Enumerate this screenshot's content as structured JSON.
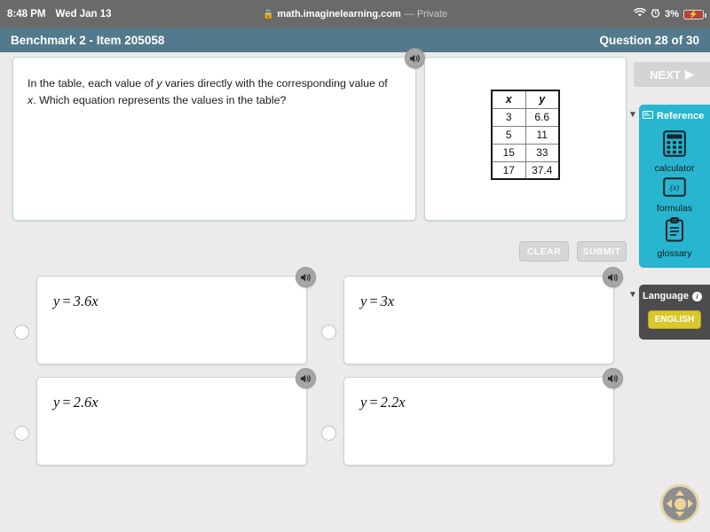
{
  "statusbar": {
    "time": "8:48 PM",
    "date": "Wed Jan 13",
    "lock_icon": "lock-icon",
    "url": "math.imaginelearning.com",
    "private_label": "— Private",
    "wifi_icon": "wifi-icon",
    "alarm_icon": "alarm-clock-icon",
    "battery_percent": "3%",
    "battery_icon": "battery-charging-icon",
    "bg_color": "#6a6a6a"
  },
  "header": {
    "title": "Benchmark 2 - Item 205058",
    "progress": "Question 28 of 30",
    "bg_color": "#52798c"
  },
  "question": {
    "speaker_icon": "speaker-icon",
    "line1_a": "In the table, each value of ",
    "line1_y": "y",
    "line1_b": " varies directly with the corresponding value of",
    "line2_x": "x",
    "line2_b": ". Which equation represents the values in the table?"
  },
  "stimulus_table": {
    "headers": [
      "x",
      "y"
    ],
    "rows": [
      [
        "3",
        "6.6"
      ],
      [
        "5",
        "11"
      ],
      [
        "15",
        "33"
      ],
      [
        "17",
        "37.4"
      ]
    ]
  },
  "actions": {
    "clear_label": "CLEAR",
    "submit_label": "SUBMIT",
    "disabled": true
  },
  "choices": [
    {
      "id": "choice-a",
      "lhs": "y",
      "op": "=",
      "rhs": "3.6x",
      "selected": false,
      "speaker_icon": "speaker-icon"
    },
    {
      "id": "choice-b",
      "lhs": "y",
      "op": "=",
      "rhs": "3x",
      "selected": false,
      "speaker_icon": "speaker-icon"
    },
    {
      "id": "choice-c",
      "lhs": "y",
      "op": "=",
      "rhs": "2.6x",
      "selected": false,
      "speaker_icon": "speaker-icon"
    },
    {
      "id": "choice-d",
      "lhs": "y",
      "op": "=",
      "rhs": "2.2x",
      "selected": false,
      "speaker_icon": "speaker-icon"
    }
  ],
  "rail": {
    "next_label": "NEXT",
    "next_icon": "play-triangle-icon",
    "reference": {
      "title": "Reference",
      "title_icon": "reference-card-icon",
      "collapse_icon": "caret-down-icon",
      "bg_color": "#27b5cf",
      "tools": [
        {
          "label": "calculator",
          "icon": "calculator-icon"
        },
        {
          "label": "formulas",
          "icon": "formulas-fx-icon"
        },
        {
          "label": "glossary",
          "icon": "clipboard-icon"
        }
      ]
    },
    "language": {
      "title": "Language",
      "info_icon": "info-icon",
      "collapse_icon": "caret-down-icon",
      "bg_color": "#4c4c4c",
      "button_label": "ENGLISH",
      "button_color": "#d9c72b"
    }
  },
  "dpad": {
    "name": "directional-pad-control",
    "ring_color": "#e3d5a8",
    "hub_color": "#f0d59a"
  }
}
